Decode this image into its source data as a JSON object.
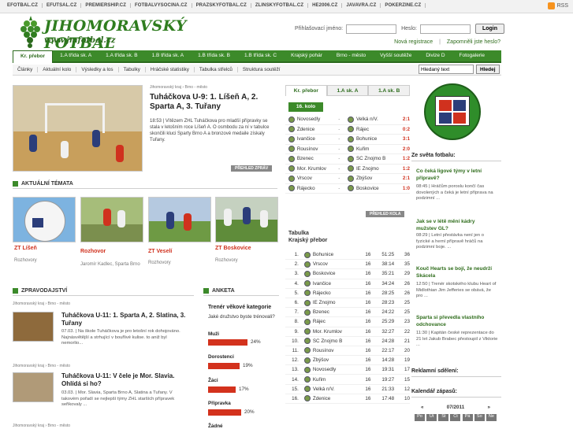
{
  "toplinks": [
    "EFOTBAL.CZ",
    "EFUTSAL.CZ",
    "PREMIERSHIP.CZ",
    "FOTBALVYSOCINA.CZ",
    "PRAZSKYFOTBAL.CZ",
    "ZLINSKYFOTBAL.CZ",
    "HE2006.CZ",
    "JAVAVRA.CZ",
    "POKERZINE.CZ"
  ],
  "rss": "RSS",
  "logo": {
    "title": "JIHOMORAVSKÝ FOTBAL",
    "url": "www.jmfotbal.cz"
  },
  "login": {
    "user_label": "Přihlašovací jméno:",
    "pass_label": "Heslo:",
    "button": "Login",
    "register": "Nová registrace",
    "forgot": "Zapomněli jste heslo?"
  },
  "nav": [
    "Kr. přebor",
    "1.A třída sk. A",
    "1.A třída sk. B",
    "1.B třída sk. A",
    "1.B třída sk. B",
    "1.B třída sk. C",
    "Krajský pohár",
    "Brno - město",
    "Vyšší soutěže",
    "Divize D",
    "Fotogalerie"
  ],
  "subnav": [
    "Články",
    "Aktuální kolo",
    "Výsledky a los",
    "Tabulky",
    "Hráčské statistiky",
    "Tabulka střelců",
    "Struktura soutěží"
  ],
  "search": {
    "value": "Hledaný text",
    "button": "Hledej"
  },
  "hero": {
    "crumb": "Jihomoravský kraj › Brno - město",
    "title": "Tuháčkova U-9: 1. Líšeň A, 2. Sparta A, 3. Tuřany",
    "text": "18:53 | Vítězem ZHL Tuháčkova pro mladší přípravky se stala v letošním roce Líšeň A. O osmbodu za ní v tabulce skončili kluci Sparty Brno A a bronzové medaile získaly Tuřany.",
    "button": "PŘEHLED ZPRÁV"
  },
  "topics": {
    "heading": "AKTUÁLNÍ TÉMATA",
    "items": [
      {
        "title": "ZT Líšeň",
        "sub": "Rozhovory"
      },
      {
        "title": "Rozhovor",
        "sub": "Jaromír Kadlec, Sparta Brno"
      },
      {
        "title": "ZT Veselí",
        "sub": "Rozhovory"
      },
      {
        "title": "ZT Boskovice",
        "sub": "Rozhovory"
      }
    ]
  },
  "news": {
    "heading": "ZPRAVODAJSTVÍ",
    "items": [
      {
        "crumb": "Jihomoravský kraj › Brno - město",
        "title": "Tuháčkova U-11: 1. Sparta A, 2. Slatina, 3. Tuřany",
        "text": "07.03. | Na škole Tuháčkova je pro letošní rok dohojováno. Najnásvětější a strhující v bouřlivé kulise. to aniž byl nemorlio..."
      },
      {
        "crumb": "Jihomoravský kraj › Brno - město",
        "title": "Tuháčkova U-11: V čele je Mor. Slavia. Ohlídá si ho?",
        "text": "03.03. | Mor. Slavia, Sparta Brno A, Slatina a Tuřany. V takovém pořadí se nejlepší týmy ZHL starších přípravek seřikovaly ..."
      },
      {
        "crumb": "Jihomoravský kraj › Brno - město"
      }
    ]
  },
  "poll": {
    "heading": "ANKETA",
    "title": "Trenér věkové kategorie",
    "question": "Jaké družstvo byste trénovali?",
    "options": [
      {
        "name": "Muži",
        "pct": 24,
        "label": "24%"
      },
      {
        "name": "Dorostenci",
        "pct": 19,
        "label": "19%"
      },
      {
        "name": "Žáci",
        "pct": 17,
        "label": "17%"
      },
      {
        "name": "Přípravka",
        "pct": 20,
        "label": "20%"
      },
      {
        "name": "Žádné",
        "pct": 0,
        "label": ""
      }
    ]
  },
  "league": {
    "tabs": [
      "Kr. přebor",
      "1.A sk. A",
      "1.A sk. B"
    ],
    "round": "16. kolo",
    "matches": [
      {
        "home": "Novosedly",
        "away": "Velká n/V.",
        "score": "2:1"
      },
      {
        "home": "Ždenice",
        "away": "Rájec",
        "score": "0:2"
      },
      {
        "home": "Ivančice",
        "away": "Bohunice",
        "score": "3:1"
      },
      {
        "home": "Rousínov",
        "away": "Kuřim",
        "score": "2:0"
      },
      {
        "home": "Bzenec",
        "away": "SC Znojmo B",
        "score": "1:2"
      },
      {
        "home": "Mor. Krumlov",
        "away": "IE Znojmo",
        "score": "1:2"
      },
      {
        "home": "Vrscov",
        "away": "Zbýšov",
        "score": "2:1"
      },
      {
        "home": "Rájecko",
        "away": "Boskovice",
        "score": "1:0"
      }
    ],
    "matches_button": "PŘEHLED KOLA",
    "table_title": "Tabulka",
    "table_sub": "Krajský přebor",
    "standings": [
      {
        "pos": "1.",
        "team": "Bohunice",
        "gp": "16",
        "score": "51:25",
        "pts": "36"
      },
      {
        "pos": "2.",
        "team": "Vrscov",
        "gp": "16",
        "score": "38:14",
        "pts": "35"
      },
      {
        "pos": "3.",
        "team": "Boskovice",
        "gp": "16",
        "score": "35:21",
        "pts": "29"
      },
      {
        "pos": "4.",
        "team": "Ivančice",
        "gp": "16",
        "score": "34:24",
        "pts": "26"
      },
      {
        "pos": "5.",
        "team": "Rájecko",
        "gp": "16",
        "score": "28:25",
        "pts": "26"
      },
      {
        "pos": "6.",
        "team": "IE Znojmo",
        "gp": "16",
        "score": "28:23",
        "pts": "25"
      },
      {
        "pos": "7.",
        "team": "Bzenec",
        "gp": "16",
        "score": "24:22",
        "pts": "25"
      },
      {
        "pos": "8.",
        "team": "Rájec",
        "gp": "16",
        "score": "25:29",
        "pts": "23"
      },
      {
        "pos": "9.",
        "team": "Mor. Krumlov",
        "gp": "16",
        "score": "32:27",
        "pts": "22"
      },
      {
        "pos": "10.",
        "team": "SC Znojmo B",
        "gp": "16",
        "score": "24:28",
        "pts": "21"
      },
      {
        "pos": "11.",
        "team": "Rousínov",
        "gp": "16",
        "score": "22:17",
        "pts": "20"
      },
      {
        "pos": "12.",
        "team": "Zbýšov",
        "gp": "16",
        "score": "14:28",
        "pts": "19"
      },
      {
        "pos": "13.",
        "team": "Novosedly",
        "gp": "16",
        "score": "19:31",
        "pts": "17"
      },
      {
        "pos": "14.",
        "team": "Kuřim",
        "gp": "16",
        "score": "19:27",
        "pts": "15"
      },
      {
        "pos": "15.",
        "team": "Velká n/V.",
        "gp": "16",
        "score": "21:33",
        "pts": "12"
      },
      {
        "pos": "16.",
        "team": "Ždenice",
        "gp": "16",
        "score": "17:48",
        "pts": "10"
      }
    ]
  },
  "right": {
    "world_heading": "Ze světa fotbalu:",
    "world": [
      {
        "title": "Co čeká ligové týmy v letní přípravě?",
        "text": "08:45 | Hráčům poroslu končí čas dovolených a čeká je letní příprava na podzimní ..."
      },
      {
        "title": "Jak se v létě mění kádry mužstev GL?",
        "text": "08:29 | Letní přestávka není jen o fyzické a herní přípravě hráčů na podzimní boje. ..."
      },
      {
        "title": "Kouč Hearts se bojí, že neudrží Skácela",
        "text": "12:50 | Trenér skotského klubu Heart of Midlothian Jim Jefferies se obává, že pro ..."
      },
      {
        "title": "Sparta si převedla vlastního odchovance",
        "text": "11:30 | Kapitán české reprezentace do 21 let Jakub Brabec přestoupil z Viktorie ..."
      }
    ],
    "ads_heading": "Reklamní sdělení:",
    "cal_heading": "Kalendář zápasů:",
    "cal_month": "07/2011",
    "cal_prev": "«",
    "cal_next": "»",
    "cal_days": [
      "Po",
      "Út",
      "St",
      "Čt",
      "Pá",
      "So",
      "Ne"
    ]
  },
  "colors": {
    "accent": "#3c8a2a",
    "red": "#d0311e"
  }
}
